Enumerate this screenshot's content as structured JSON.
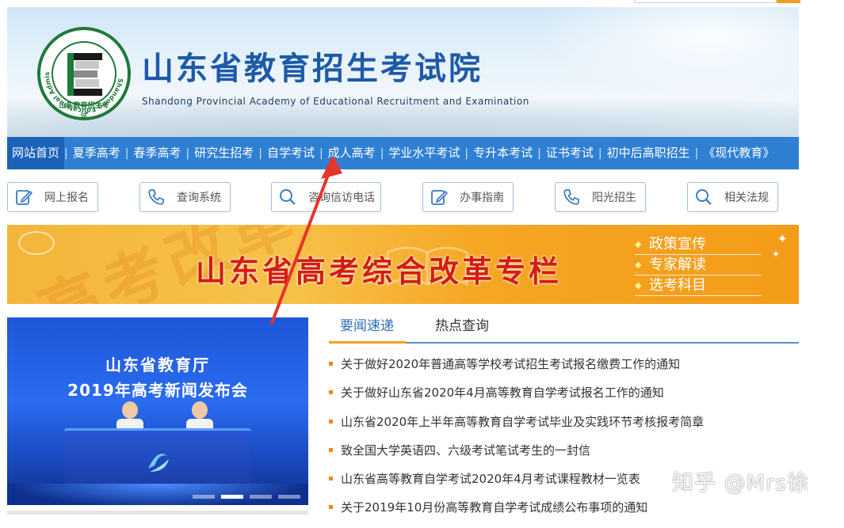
{
  "header": {
    "title": "山东省教育招生考试院",
    "subtitle": "Shandong Provincial Academy of Educational Recruitment and Examination",
    "logo_ring_text": "Shandong Educational Admission & Examinations",
    "logo_bottom_text": "山东教育招生考试"
  },
  "nav": {
    "items": [
      {
        "label": "网站首页"
      },
      {
        "label": "夏季高考"
      },
      {
        "label": "春季高考"
      },
      {
        "label": "研究生招考"
      },
      {
        "label": "自学考试"
      },
      {
        "label": "成人高考"
      },
      {
        "label": "学业水平考试"
      },
      {
        "label": "专升本考试"
      },
      {
        "label": "证书考试"
      },
      {
        "label": "初中后高职招生"
      },
      {
        "label": "《现代教育》"
      }
    ]
  },
  "quick_links": [
    {
      "label": "网上报名",
      "icon": "edit-icon"
    },
    {
      "label": "查询系统",
      "icon": "phone-icon"
    },
    {
      "label": "咨询信访电话",
      "icon": "search-icon"
    },
    {
      "label": "办事指南",
      "icon": "edit-icon"
    },
    {
      "label": "阳光招生",
      "icon": "phone-icon"
    },
    {
      "label": "相关法规",
      "icon": "search-icon"
    }
  ],
  "promo": {
    "title": "山东省高考综合改革专栏",
    "background_text": "高考改革",
    "links": [
      "政策宣传",
      "专家解读",
      "选考科目"
    ]
  },
  "photo": {
    "line1": "山东省教育厅",
    "line2": "2019年高考新闻发布会"
  },
  "news": {
    "tabs": [
      "要闻速递",
      "热点查询"
    ],
    "items": [
      "关于做好2020年普通高等学校考试招生考试报名缴费工作的通知",
      "关于做好山东省2020年4月高等教育自学考试报名工作的通知",
      "山东省2020年上半年高等教育自学考试毕业及实践环节考核报考简章",
      "致全国大学英语四、六级考试笔试考生的一封信",
      "山东省高等教育自学考试2020年4月考试课程教材一览表",
      "关于2019年10月份高等教育自学考试成绩公布事项的通知"
    ]
  },
  "watermark": "知乎 @Mrs徐",
  "colors": {
    "nav_bg": "#2f7fd3",
    "title_blue": "#1d5aa8",
    "promo_red": "#d31d10",
    "bullet_orange": "#e88a1a",
    "arrow_red": "#e8342a"
  }
}
